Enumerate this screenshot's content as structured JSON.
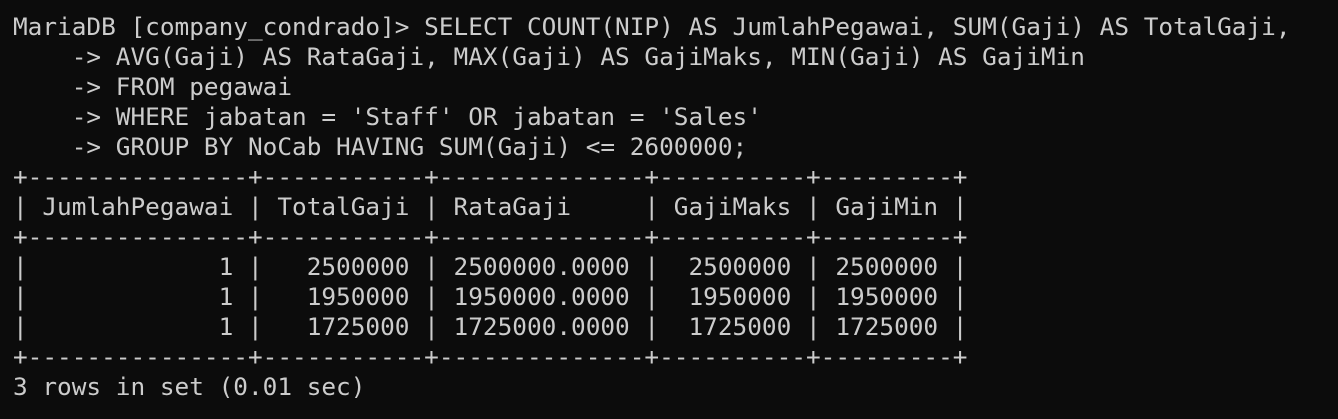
{
  "terminal": {
    "lines": [
      "MariaDB [company_condrado]> SELECT COUNT(NIP) AS JumlahPegawai, SUM(Gaji) AS TotalGaji,",
      "    -> AVG(Gaji) AS RataGaji, MAX(Gaji) AS GajiMaks, MIN(Gaji) AS GajiMin",
      "    -> FROM pegawai",
      "    -> WHERE jabatan = 'Staff' OR jabatan = 'Sales'",
      "    -> GROUP BY NoCab HAVING SUM(Gaji) <= 2600000;",
      "+---------------+-----------+--------------+----------+---------+",
      "| JumlahPegawai | TotalGaji | RataGaji     | GajiMaks | GajiMin |",
      "+---------------+-----------+--------------+----------+---------+",
      "|             1 |   2500000 | 2500000.0000 |  2500000 | 2500000 |",
      "|             1 |   1950000 | 1950000.0000 |  1950000 | 1950000 |",
      "|             1 |   1725000 | 1725000.0000 |  1725000 | 1725000 |",
      "+---------------+-----------+--------------+----------+---------+",
      "3 rows in set (0.01 sec)"
    ]
  },
  "colors": {
    "background": "#0c0c0c",
    "foreground": "#cccccc"
  }
}
